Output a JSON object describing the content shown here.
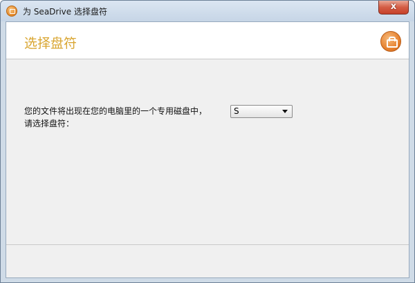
{
  "window": {
    "title": "为 SeaDrive 选择盘符",
    "close_label": "x"
  },
  "header": {
    "title": "选择盘符",
    "logo_icon": "seadrive-logo-icon"
  },
  "content": {
    "prompt": "您的文件将出现在您的电脑里的一个专用磁盘中，请选择盘符：",
    "drive_select": {
      "selected": "S"
    }
  },
  "colors": {
    "header_title": "#d9a632",
    "accent": "#e57e2b",
    "panel_bg": "#f0f0f0"
  }
}
